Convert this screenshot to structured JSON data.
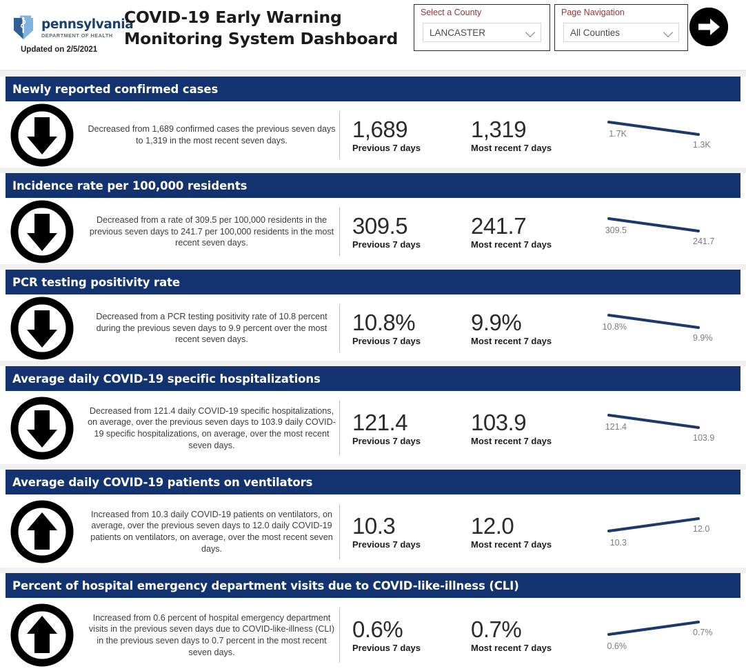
{
  "header": {
    "logo": {
      "brand": "pennsylvania",
      "subbrand": "DEPARTMENT OF HEALTH",
      "icon": "pa-keystone-caduceus-logo"
    },
    "updated": "Updated on 2/5/2021",
    "title": "COVID-19 Early Warning Monitoring System Dashboard",
    "county_select": {
      "label": "Select a County",
      "value": "LANCASTER",
      "icon": "chevron-down-icon"
    },
    "page_navigation": {
      "label": "Page Navigation",
      "value": "All Counties",
      "icon": "chevron-down-icon"
    },
    "next_button_icon": "arrow-right-circle-icon"
  },
  "labels": {
    "previous": "Previous 7 days",
    "recent": "Most recent 7 days"
  },
  "colors": {
    "banner": "#123370",
    "spark_line": "#1b3a6b",
    "label_red": "#a03232",
    "brand_blue": "#19406e"
  },
  "sections": [
    {
      "title": "Newly reported confirmed cases",
      "trend": "down",
      "trend_icon": "arrow-down-circle-icon",
      "description": "Decreased from 1,689 confirmed cases the previous seven days to 1,319 in the most recent seven days.",
      "previous_value": "1,689",
      "recent_value": "1,319",
      "spark_left_label": "1.7K",
      "spark_right_label": "1.3K"
    },
    {
      "title": "Incidence rate per 100,000 residents",
      "trend": "down",
      "trend_icon": "arrow-down-circle-icon",
      "description": "Decreased from a rate of 309.5 per 100,000 residents in the previous seven days to 241.7 per 100,000 residents in the most recent seven days.",
      "previous_value": "309.5",
      "recent_value": "241.7",
      "spark_left_label": "309.5",
      "spark_right_label": "241.7"
    },
    {
      "title": "PCR testing positivity rate",
      "trend": "down",
      "trend_icon": "arrow-down-circle-icon",
      "description": "Decreased from a PCR testing positivity rate of 10.8 percent during the previous seven days to 9.9 percent over the most recent seven days.",
      "previous_value": "10.8%",
      "recent_value": "9.9%",
      "spark_left_label": "10.8%",
      "spark_right_label": "9.9%"
    },
    {
      "title": "Average daily COVID-19 specific hospitalizations",
      "trend": "down",
      "trend_icon": "arrow-down-circle-icon",
      "description": "Decreased from 121.4 daily COVID-19 specific hospitalizations, on average, over the previous seven days to 103.9 daily COVID-19 specific hospitalizations, on average, over the most recent seven days.",
      "previous_value": "121.4",
      "recent_value": "103.9",
      "spark_left_label": "121.4",
      "spark_right_label": "103.9"
    },
    {
      "title": "Average daily COVID-19 patients on ventilators",
      "trend": "up",
      "trend_icon": "arrow-up-circle-icon",
      "description": "Increased from 10.3 daily COVID-19 patients on ventilators, on average, over the previous seven days to 12.0 daily COVID-19 patients on ventilators, on average, over the most recent seven days.",
      "previous_value": "10.3",
      "recent_value": "12.0",
      "spark_left_label": "10.3",
      "spark_right_label": "12.0"
    },
    {
      "title": "Percent of hospital emergency department visits due to COVID-like-illness (CLI)",
      "trend": "up",
      "trend_icon": "arrow-up-circle-icon",
      "description": "Increased from 0.6 percent of hospital emergency department visits in the previous seven days due to COVID-like-illness (CLI) in the previous seven days to 0.7 percent in the most recent seven days.",
      "previous_value": "0.6%",
      "recent_value": "0.7%",
      "spark_left_label": "0.6%",
      "spark_right_label": "0.7%"
    }
  ],
  "chart_data": [
    {
      "type": "line",
      "title": "Newly reported confirmed cases",
      "categories": [
        "Previous 7 days",
        "Most recent 7 days"
      ],
      "values": [
        1689,
        1319
      ],
      "point_labels": [
        "1.7K",
        "1.3K"
      ],
      "direction": "down",
      "grid": false,
      "legend": "none"
    },
    {
      "type": "line",
      "title": "Incidence rate per 100,000 residents",
      "categories": [
        "Previous 7 days",
        "Most recent 7 days"
      ],
      "values": [
        309.5,
        241.7
      ],
      "point_labels": [
        "309.5",
        "241.7"
      ],
      "direction": "down",
      "grid": false,
      "legend": "none"
    },
    {
      "type": "line",
      "title": "PCR testing positivity rate",
      "categories": [
        "Previous 7 days",
        "Most recent 7 days"
      ],
      "values": [
        10.8,
        9.9
      ],
      "point_labels": [
        "10.8%",
        "9.9%"
      ],
      "direction": "down",
      "grid": false,
      "legend": "none"
    },
    {
      "type": "line",
      "title": "Average daily COVID-19 specific hospitalizations",
      "categories": [
        "Previous 7 days",
        "Most recent 7 days"
      ],
      "values": [
        121.4,
        103.9
      ],
      "point_labels": [
        "121.4",
        "103.9"
      ],
      "direction": "down",
      "grid": false,
      "legend": "none"
    },
    {
      "type": "line",
      "title": "Average daily COVID-19 patients on ventilators",
      "categories": [
        "Previous 7 days",
        "Most recent 7 days"
      ],
      "values": [
        10.3,
        12.0
      ],
      "point_labels": [
        "10.3",
        "12.0"
      ],
      "direction": "up",
      "grid": false,
      "legend": "none"
    },
    {
      "type": "line",
      "title": "Percent of hospital emergency department visits due to COVID-like-illness (CLI)",
      "categories": [
        "Previous 7 days",
        "Most recent 7 days"
      ],
      "values": [
        0.6,
        0.7
      ],
      "point_labels": [
        "0.6%",
        "0.7%"
      ],
      "direction": "up",
      "grid": false,
      "legend": "none"
    }
  ]
}
